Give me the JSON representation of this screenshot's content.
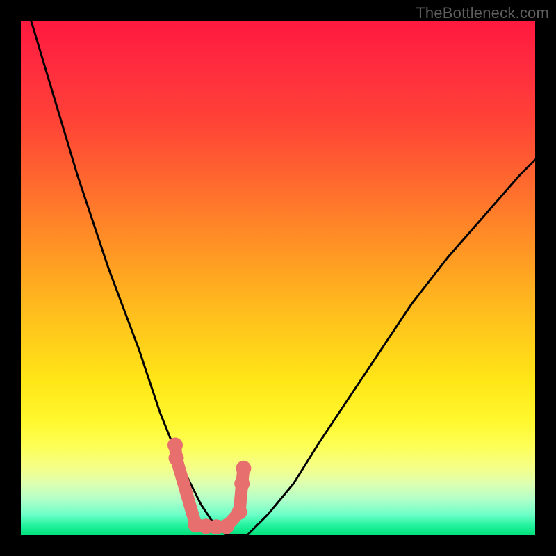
{
  "watermark": "TheBottleneck.com",
  "chart_data": {
    "type": "line",
    "title": "",
    "xlabel": "",
    "ylabel": "",
    "xlim": [
      0,
      100
    ],
    "ylim": [
      0,
      100
    ],
    "series": [
      {
        "name": "bottleneck-curve",
        "x": [
          2,
          5,
          8,
          11,
          14,
          17,
          20,
          23,
          25,
          27,
          29,
          31,
          33,
          35,
          37,
          40,
          44,
          48,
          53,
          58,
          64,
          70,
          76,
          83,
          90,
          97,
          100
        ],
        "values": [
          100,
          90,
          80,
          70,
          61,
          52,
          44,
          36,
          30,
          24,
          19,
          14,
          10,
          6,
          3,
          0,
          0,
          4,
          10,
          18,
          27,
          36,
          45,
          54,
          62,
          70,
          73
        ]
      },
      {
        "name": "data-beads",
        "x": [
          30.0,
          30.2,
          34.0,
          36.0,
          38.0,
          40.0,
          42.5,
          43.0,
          43.3
        ],
        "values": [
          17.5,
          15.0,
          2.0,
          1.7,
          1.6,
          1.7,
          4.5,
          10.0,
          13.0
        ]
      }
    ],
    "colors": {
      "curve": "#000000",
      "beads": "#e76f6d"
    }
  }
}
